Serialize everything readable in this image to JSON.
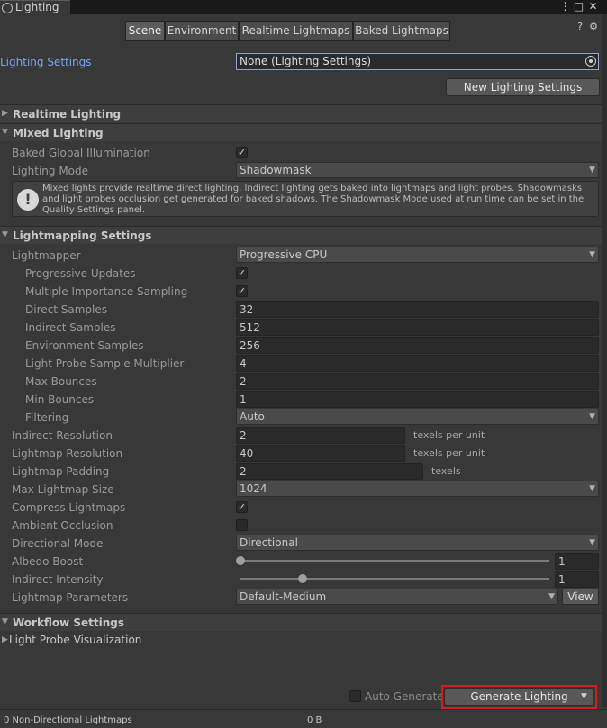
{
  "window": {
    "tab_title": "Lighting",
    "menu_icon": "kebab-menu-icon",
    "maximize_icon": "maximize-icon",
    "close_icon": "close-icon"
  },
  "tabs": [
    {
      "label": "Scene",
      "active": true
    },
    {
      "label": "Environment",
      "active": false
    },
    {
      "label": "Realtime Lightmaps",
      "active": false
    },
    {
      "label": "Baked Lightmaps",
      "active": false
    }
  ],
  "header_icons": {
    "help": "help-icon",
    "settings": "gear-icon"
  },
  "lighting_settings": {
    "label": "Lighting Settings",
    "value": "None (Lighting Settings)",
    "new_button": "New Lighting Settings"
  },
  "sections": {
    "realtime": "Realtime Lighting",
    "mixed": "Mixed Lighting",
    "lightmapping": "Lightmapping Settings",
    "workflow": "Workflow Settings",
    "light_probe_vis": "Light Probe Visualization"
  },
  "mixed": {
    "baked_gi_label": "Baked Global Illumination",
    "baked_gi_checked": true,
    "lighting_mode_label": "Lighting Mode",
    "lighting_mode_value": "Shadowmask",
    "help_text": "Mixed lights provide realtime direct lighting. Indirect lighting gets baked into lightmaps and light probes. Shadowmasks and light probes occlusion get generated for baked shadows. The Shadowmask Mode used at run time can be set in the Quality Settings panel."
  },
  "lightmapping": {
    "lightmapper": {
      "label": "Lightmapper",
      "value": "Progressive CPU"
    },
    "progressive_updates": {
      "label": "Progressive Updates",
      "checked": true
    },
    "mis": {
      "label": "Multiple Importance Sampling",
      "checked": true
    },
    "direct_samples": {
      "label": "Direct Samples",
      "value": "32"
    },
    "indirect_samples": {
      "label": "Indirect Samples",
      "value": "512"
    },
    "environment_samples": {
      "label": "Environment Samples",
      "value": "256"
    },
    "lp_multiplier": {
      "label": "Light Probe Sample Multiplier",
      "value": "4"
    },
    "max_bounces": {
      "label": "Max Bounces",
      "value": "2"
    },
    "min_bounces": {
      "label": "Min Bounces",
      "value": "1"
    },
    "filtering": {
      "label": "Filtering",
      "value": "Auto"
    },
    "indirect_resolution": {
      "label": "Indirect Resolution",
      "value": "2",
      "unit": "texels per unit"
    },
    "lightmap_resolution": {
      "label": "Lightmap Resolution",
      "value": "40",
      "unit": "texels per unit"
    },
    "lightmap_padding": {
      "label": "Lightmap Padding",
      "value": "2",
      "unit": "texels"
    },
    "max_lightmap_size": {
      "label": "Max Lightmap Size",
      "value": "1024"
    },
    "compress_lightmaps": {
      "label": "Compress Lightmaps",
      "checked": true
    },
    "ambient_occlusion": {
      "label": "Ambient Occlusion",
      "checked": false
    },
    "directional_mode": {
      "label": "Directional Mode",
      "value": "Directional"
    },
    "albedo_boost": {
      "label": "Albedo Boost",
      "value": "1",
      "slider_fraction": 0.0
    },
    "indirect_intensity": {
      "label": "Indirect Intensity",
      "value": "1",
      "slider_fraction": 0.2
    },
    "lightmap_parameters": {
      "label": "Lightmap Parameters",
      "value": "Default-Medium",
      "view_button": "View"
    }
  },
  "bottom": {
    "auto_generate_label": "Auto Generate",
    "auto_generate_checked": false,
    "generate_button": "Generate Lighting",
    "status_left": "0 Non-Directional Lightmaps",
    "status_right": "0 B"
  },
  "colors": {
    "background": "#383838",
    "link_label": "#7ba4f0",
    "highlight_outline": "#d21e1e"
  }
}
